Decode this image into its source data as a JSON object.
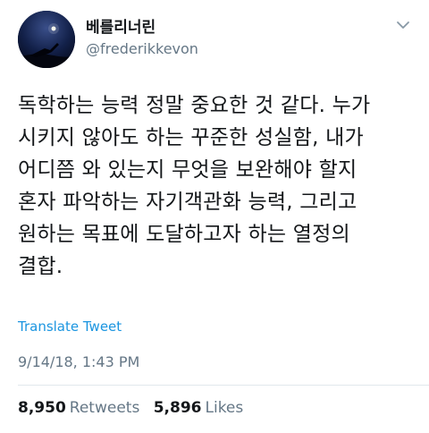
{
  "user": {
    "display_name": "베를리너린",
    "handle": "@frederikkevon"
  },
  "tweet": {
    "text": "독학하는 능력 정말 중요한 것 같다. 누가\n시키지 않아도 하는 꾸준한 성실함, 내가\n어디쯤 와 있는지 무엇을 보완해야 할지\n혼자 파악하는 자기객관화 능력, 그리고\n원하는 목표에 도달하고자 하는 열정의\n결합.",
    "translate_label": "Translate Tweet",
    "timestamp": "9/14/18, 1:43 PM"
  },
  "stats": {
    "retweets_count": "8,950",
    "retweets_label": "Retweets",
    "likes_count": "5,896",
    "likes_label": "Likes"
  },
  "icons": {
    "menu": "chevron-down-icon"
  },
  "colors": {
    "link": "#1b95e0",
    "secondary_text": "#657786",
    "primary_text": "#14171a"
  }
}
